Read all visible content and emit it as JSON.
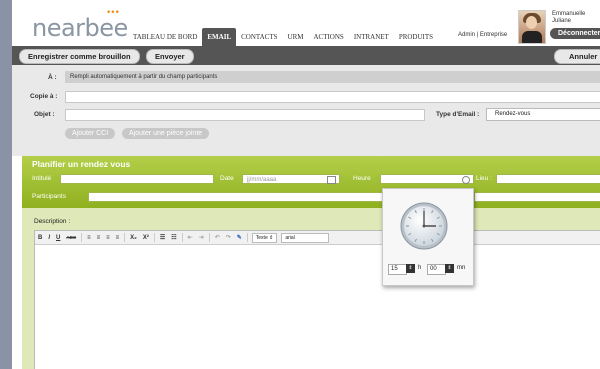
{
  "header": {
    "logo": "nearbee",
    "nav": [
      "TABLEAU DE BORD",
      "EMAIL",
      "CONTACTS",
      "URM",
      "ACTIONS",
      "INTRANET",
      "PRODUITS"
    ],
    "active_nav": "EMAIL",
    "admin_link": "Admin | Entreprise",
    "user_first": "Emmanuelle",
    "user_last": "Juliane",
    "logout": "Déconnecter"
  },
  "toolbar": {
    "draft": "Enregistrer comme brouillon",
    "send": "Envoyer",
    "cancel": "Annuler"
  },
  "form": {
    "to_label": "À :",
    "to_value": "Rempli automatiquement à partir du champ participants",
    "cc_label": "Copie à :",
    "subject_label": "Objet :",
    "email_type_label": "Type d'Email :",
    "email_type_value": "Rendez-vous",
    "add_cci": "Ajouter CCI",
    "add_attachment": "Ajouter une pièce jointe"
  },
  "meeting": {
    "title": "Planifier un rendez vous",
    "intitule_label": "Intitulé",
    "date_label": "Date",
    "date_placeholder": "jj/mm/aaaa",
    "time_label": "Heure",
    "place_label": "Lieu :",
    "participants_label": "Participants",
    "description_label": "Description :"
  },
  "editor": {
    "tools": [
      "B",
      "I",
      "U",
      "ABC",
      "≡",
      "≡",
      "≡",
      "≡",
      "X₂",
      "X²",
      "☰",
      "☷",
      "⇤",
      "⇥",
      "↶",
      "↷",
      "✎"
    ],
    "format_select": "Texte",
    "font_select": "arial"
  },
  "time_picker": {
    "hours": "15",
    "hours_unit": "h",
    "minutes": "00",
    "minutes_unit": "mn"
  },
  "colors": {
    "accent_green": "#9bbd2a",
    "logo_orange": "#f08a1c",
    "toolbar_dark": "#555555"
  }
}
